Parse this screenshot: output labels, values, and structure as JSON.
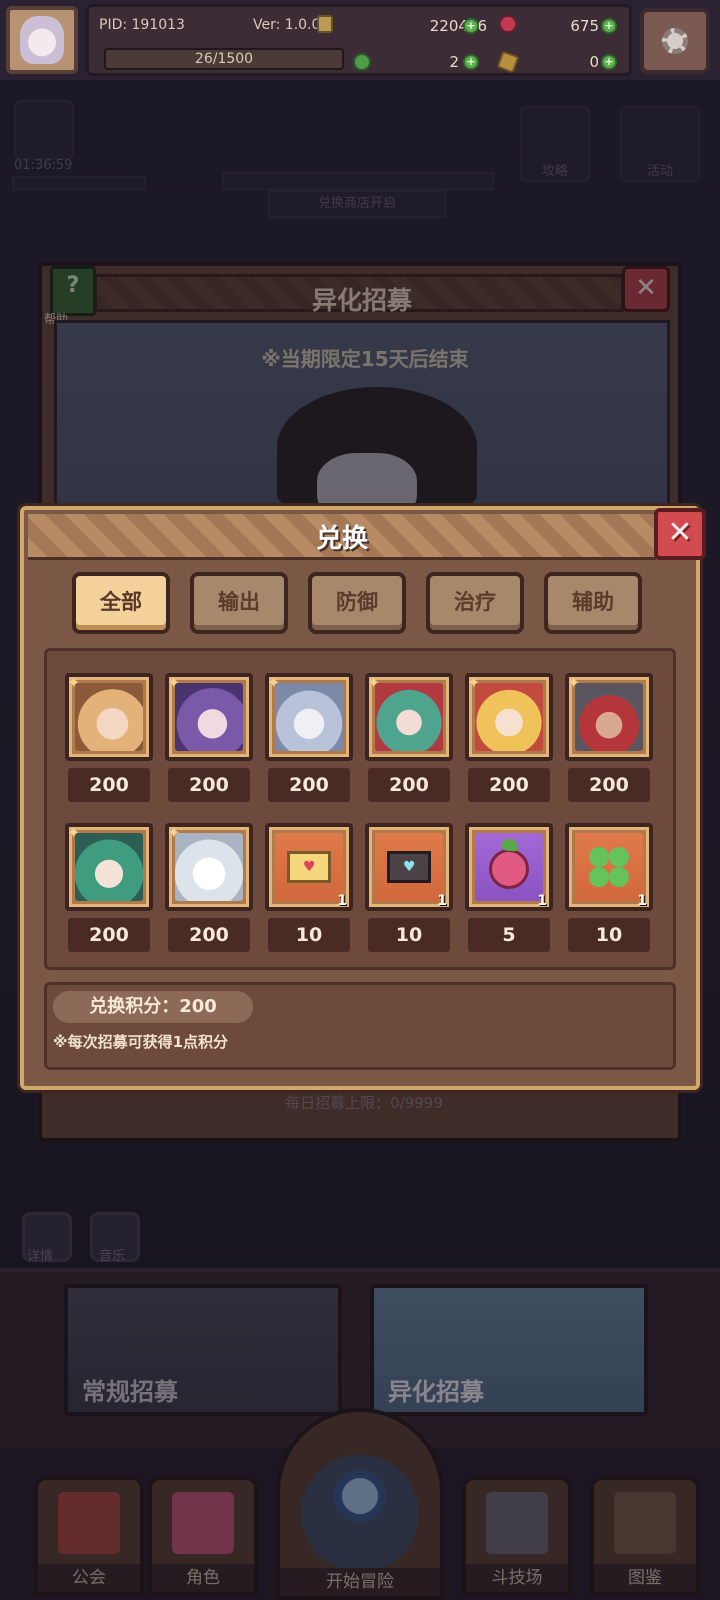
{
  "topbar": {
    "pid": "PID: 191013",
    "version": "Ver: 1.0.0.0",
    "gold": "220436",
    "gems": "675",
    "xp": "26/1500",
    "clover_count": "2",
    "key_count": "0"
  },
  "background": {
    "timer": "01:36:59",
    "guide_label": "攻略",
    "event_label": "活动",
    "shop_open_label": "兑换商店开启",
    "recruit_title": "异化招募",
    "help_label": "帮助",
    "limit_notice": "※当期限定15天后结束",
    "daily_limit": "每日招募上限：0/9999",
    "side_buttons": [
      "详情",
      "音乐"
    ],
    "recruit_tabs": [
      "常规招募",
      "异化招募"
    ]
  },
  "nav": {
    "items": [
      "公会",
      "角色",
      "开始冒险",
      "斗技场",
      "图鉴"
    ]
  },
  "exchange": {
    "title": "兑换",
    "close_symbol": "✕",
    "tabs": [
      "全部",
      "输出",
      "防御",
      "治疗",
      "辅助"
    ],
    "active_tab": "全部",
    "items": [
      {
        "kind": "hero-blonde-fox",
        "cost": "200",
        "qty": ""
      },
      {
        "kind": "hero-purple-hair",
        "cost": "200",
        "qty": ""
      },
      {
        "kind": "hero-white-dragon",
        "cost": "200",
        "qty": ""
      },
      {
        "kind": "hero-green-hair",
        "cost": "200",
        "qty": ""
      },
      {
        "kind": "hero-blonde-twintail",
        "cost": "200",
        "qty": ""
      },
      {
        "kind": "hero-grey-hat",
        "cost": "200",
        "qty": ""
      },
      {
        "kind": "hero-green-moon",
        "cost": "200",
        "qty": ""
      },
      {
        "kind": "hero-white-ghost",
        "cost": "200",
        "qty": ""
      },
      {
        "kind": "yellow-letter",
        "cost": "10",
        "qty": "1"
      },
      {
        "kind": "dark-letter",
        "cost": "10",
        "qty": "1"
      },
      {
        "kind": "pink-fruit",
        "cost": "5",
        "qty": "1"
      },
      {
        "kind": "four-leaf-clover",
        "cost": "10",
        "qty": "1"
      }
    ],
    "points_label": "兑换积分：200",
    "points_note": "※每次招募可获得1点积分"
  },
  "colors": {
    "modal_bg": "#7b5746",
    "modal_border": "#d2a76b",
    "active_tab": "#f4d09b",
    "close_red": "#d24b4e"
  }
}
